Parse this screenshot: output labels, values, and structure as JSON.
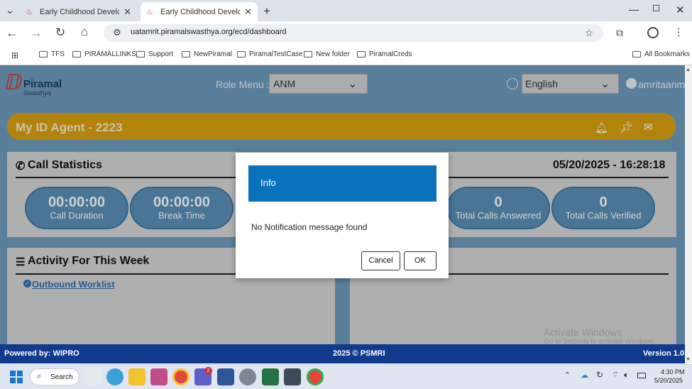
{
  "browser": {
    "tabs": [
      {
        "title": "Early Childhood Developme",
        "active": false
      },
      {
        "title": "Early Childhood Developme",
        "active": true
      }
    ],
    "new_tab": "+",
    "url": "uatamrit.piramalswasthya.org/ecd/dashboard",
    "bookmarks": [
      "TFS",
      "PIRAMALLINKS",
      "Support",
      "NewPiramal",
      "PiramalTestCase",
      "New folder",
      "PiramalCreds"
    ],
    "all_bookmarks": "All Bookmarks"
  },
  "app": {
    "logo_name": "Piramal",
    "logo_sub": "Swasthya",
    "role_menu_label": "Role Menu :",
    "role_value": "ANM",
    "language_value": "English",
    "username": "amritaanm",
    "agent_banner": "My ID Agent - 2223",
    "call_stats": {
      "title": "Call Statistics",
      "datetime": "05/20/2025 - 16:28:18",
      "items": [
        {
          "value": "00:00:00",
          "label": "Call Duration"
        },
        {
          "value": "00:00:00",
          "label": "Break Time"
        },
        {
          "value": "0",
          "label": "Total Calls Answered"
        },
        {
          "value": "0",
          "label": "Total Calls Verified"
        }
      ]
    },
    "activity": {
      "title": "Activity For This Week",
      "link": "Outbound Worklist"
    },
    "watermark_line1": "Activate Windows",
    "watermark_line2": "Go to Settings to activate Windows.",
    "colors": {
      "header": "#6d9bbd",
      "banner": "#dba211",
      "dialog_header": "#0a72bd",
      "footer": "#123a8c"
    }
  },
  "dialog": {
    "title": "Info",
    "message": "No Notification message found",
    "cancel": "Cancel",
    "ok": "OK"
  },
  "footer": {
    "powered": "Powered by: WIPRO",
    "copyright": "2025 © PSMRI",
    "version": "Version 1.0"
  },
  "taskbar": {
    "search": "Search",
    "badge": "2",
    "time": "4:30 PM",
    "date": "5/20/2025"
  }
}
